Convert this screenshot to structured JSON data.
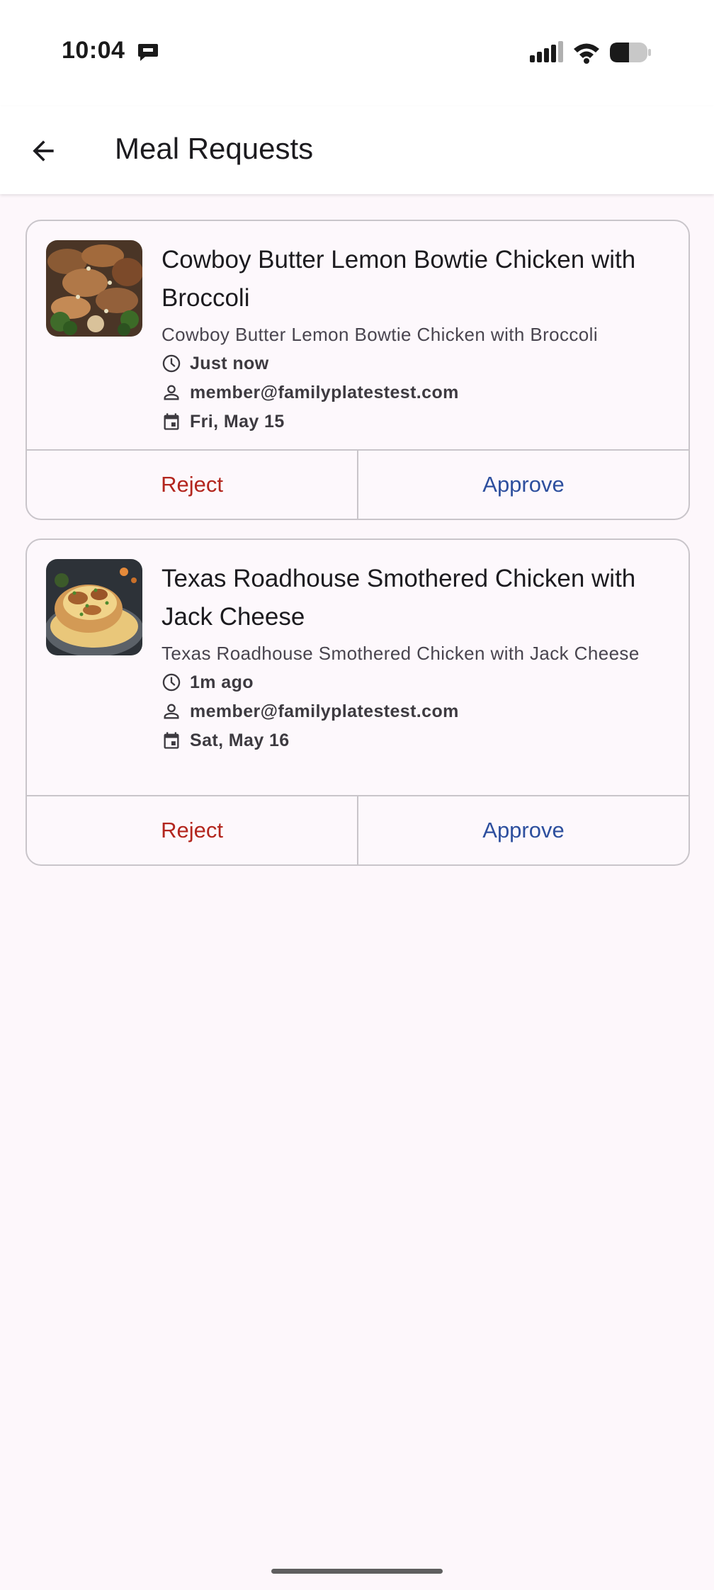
{
  "status_bar": {
    "time": "10:04",
    "icons": [
      "message-icon",
      "signal-icon",
      "wifi-icon",
      "battery-icon"
    ]
  },
  "app_bar": {
    "back_icon": "arrow-back-icon",
    "title": "Meal Requests"
  },
  "requests": [
    {
      "title": "Cowboy Butter Lemon Bowtie Chicken with Broccoli",
      "description": "Cowboy Butter Lemon Bowtie Chicken with Broccoli",
      "time": "Just now",
      "member": "member@familyplatestest.com",
      "date": "Fri, May 15",
      "reject_label": "Reject",
      "approve_label": "Approve"
    },
    {
      "title": "Texas Roadhouse Smothered Chicken with Jack Cheese",
      "description": "Texas Roadhouse Smothered Chicken with Jack Cheese",
      "time": "1m ago",
      "member": "member@familyplatestest.com",
      "date": "Sat, May 16",
      "reject_label": "Reject",
      "approve_label": "Approve"
    }
  ],
  "colors": {
    "background": "#fdf7fb",
    "reject": "#b3261e",
    "approve": "#2d4f9e",
    "border": "#c9c5ca"
  }
}
